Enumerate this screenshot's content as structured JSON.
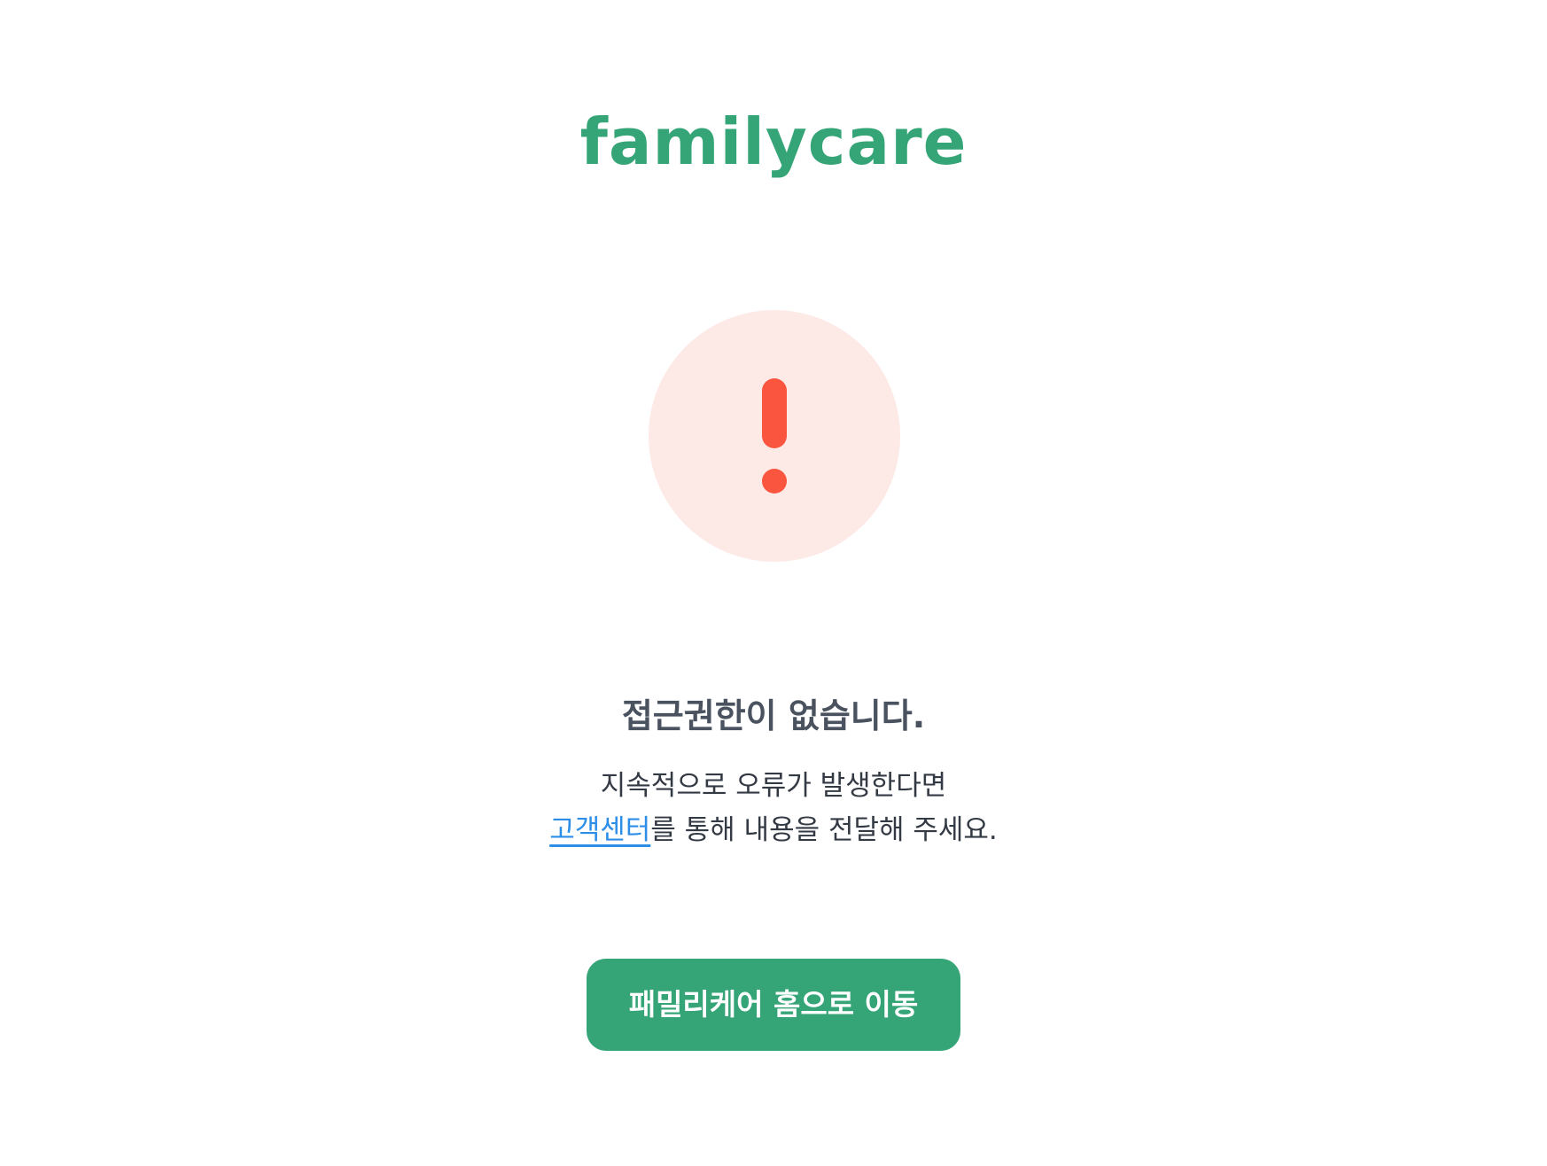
{
  "brand": {
    "logo_text": "familycare",
    "color": "#35a577"
  },
  "alert": {
    "icon": "exclamation-icon",
    "circle_color": "#fdeae7",
    "mark_color": "#f9553f"
  },
  "error": {
    "title": "접근권한이 없습니다.",
    "message_line1": "지속적으로 오류가 발생한다면",
    "support_link": "고객센터",
    "message_line2_rest": "를 통해 내용을 전달해 주세요.",
    "link_color": "#2d8ee8"
  },
  "actions": {
    "home_button_label": "패밀리케어 홈으로 이동",
    "home_button_color": "#35a577"
  }
}
